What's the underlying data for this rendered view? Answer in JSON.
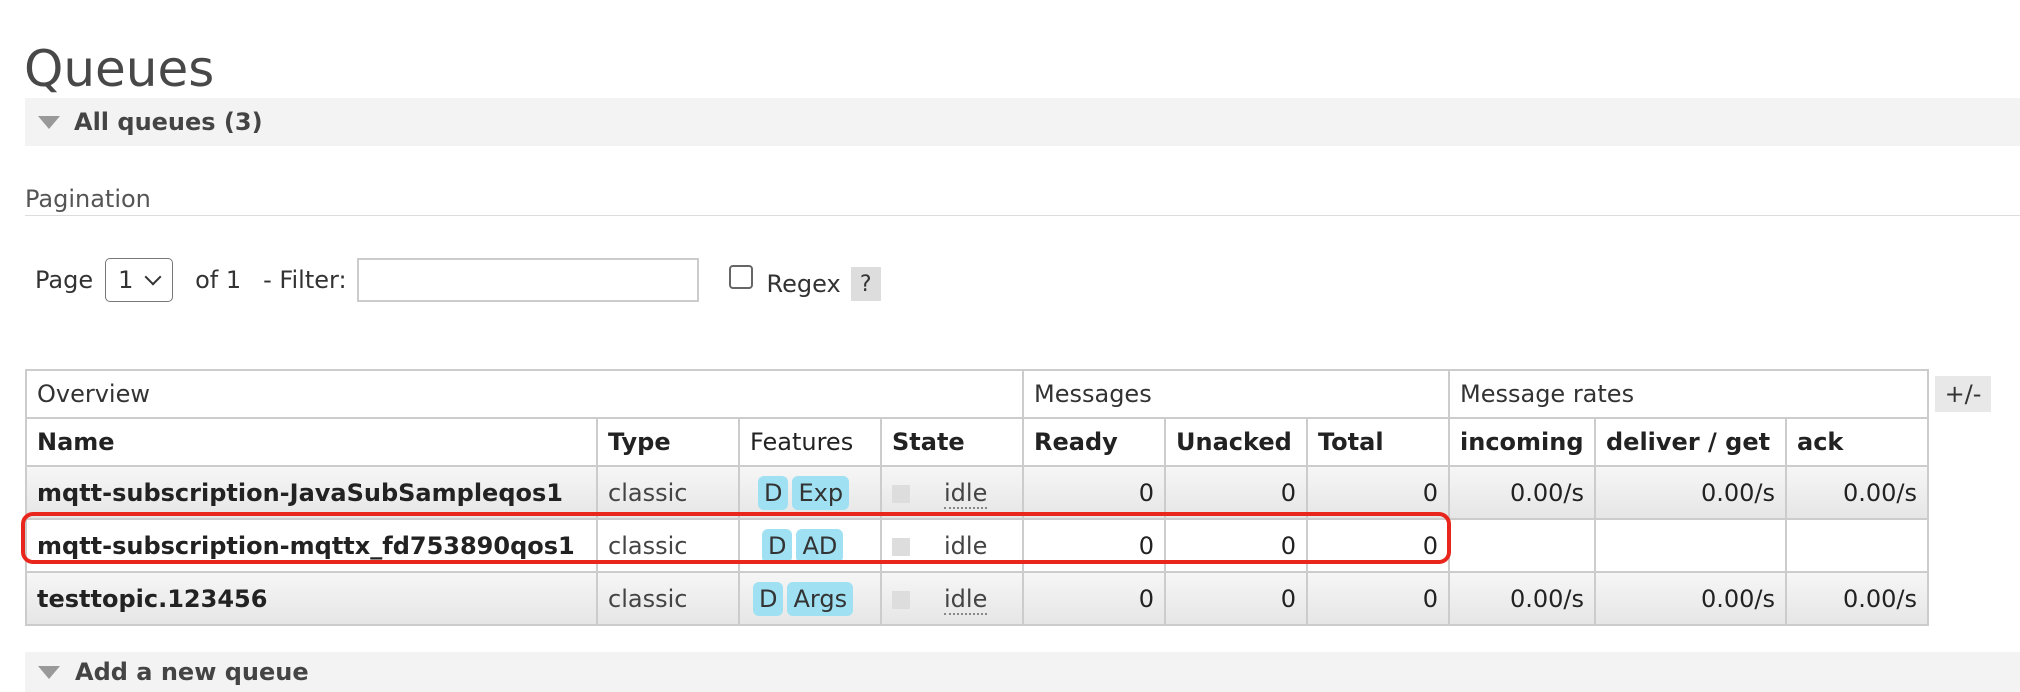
{
  "page": {
    "title": "Queues"
  },
  "section": {
    "label": "All queues (3)"
  },
  "pagination": {
    "heading": "Pagination",
    "page_label": "Page",
    "page_value": "1",
    "of_label": "of 1",
    "filter_label": "- Filter:",
    "filter_value": "",
    "regex_label": "Regex",
    "help_label": "?"
  },
  "table": {
    "groups": [
      "Overview",
      "Messages",
      "Message rates"
    ],
    "columns": [
      "Name",
      "Type",
      "Features",
      "State",
      "Ready",
      "Unacked",
      "Total",
      "incoming",
      "deliver / get",
      "ack"
    ],
    "rows": [
      {
        "name": "mqtt-subscription-JavaSubSampleqos1",
        "type": "classic",
        "features": [
          "D",
          "Exp"
        ],
        "state": "idle",
        "ready": "0",
        "unacked": "0",
        "total": "0",
        "incoming": "0.00/s",
        "deliver_get": "0.00/s",
        "ack": "0.00/s"
      },
      {
        "name": "mqtt-subscription-mqttx_fd753890qos1",
        "type": "classic",
        "features": [
          "D",
          "AD"
        ],
        "state": "idle",
        "ready": "0",
        "unacked": "0",
        "total": "0",
        "incoming": "",
        "deliver_get": "",
        "ack": ""
      },
      {
        "name": "testtopic.123456",
        "type": "classic",
        "features": [
          "D",
          "Args"
        ],
        "state": "idle",
        "ready": "0",
        "unacked": "0",
        "total": "0",
        "incoming": "0.00/s",
        "deliver_get": "0.00/s",
        "ack": "0.00/s"
      }
    ],
    "column_toggle": "+/-"
  },
  "add_section": {
    "label": "Add a new queue"
  },
  "colors": {
    "tag_bg": "#9fe1f3",
    "highlight": "#e8261c",
    "bar_bg": "#f3f3f3"
  }
}
